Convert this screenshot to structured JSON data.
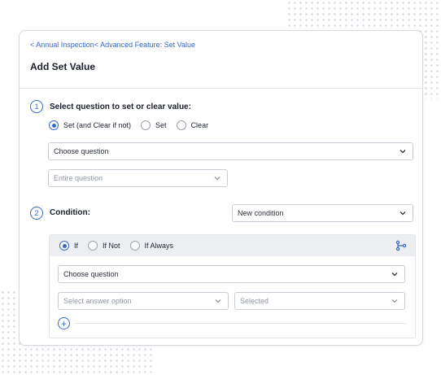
{
  "breadcrumb": {
    "item1": "< Annual Inspection",
    "item2": "< Advanced Feature: Set Value"
  },
  "page_title": "Add Set Value",
  "step1": {
    "number": "1",
    "label": "Select question to set or clear value:",
    "options": [
      "Set (and Clear if not)",
      "Set",
      "Clear"
    ],
    "selected_index": 0,
    "question_select": "Choose question",
    "scope_select": "Entire question"
  },
  "step2": {
    "number": "2",
    "label": "Condition:",
    "condition_select": "New condition",
    "mode_options": [
      "If",
      "If Not",
      "If Always"
    ],
    "selected_mode": 0,
    "question_select": "Choose question",
    "answer_select": "Select answer option",
    "state_select": "Selected"
  },
  "colors": {
    "accent": "#3768c9",
    "border": "#c9ced6",
    "panel_header": "#eceef1"
  },
  "icons": {
    "dropdown": "chevron-down-icon",
    "branch": "branch-icon",
    "add": "plus-circle-icon"
  }
}
